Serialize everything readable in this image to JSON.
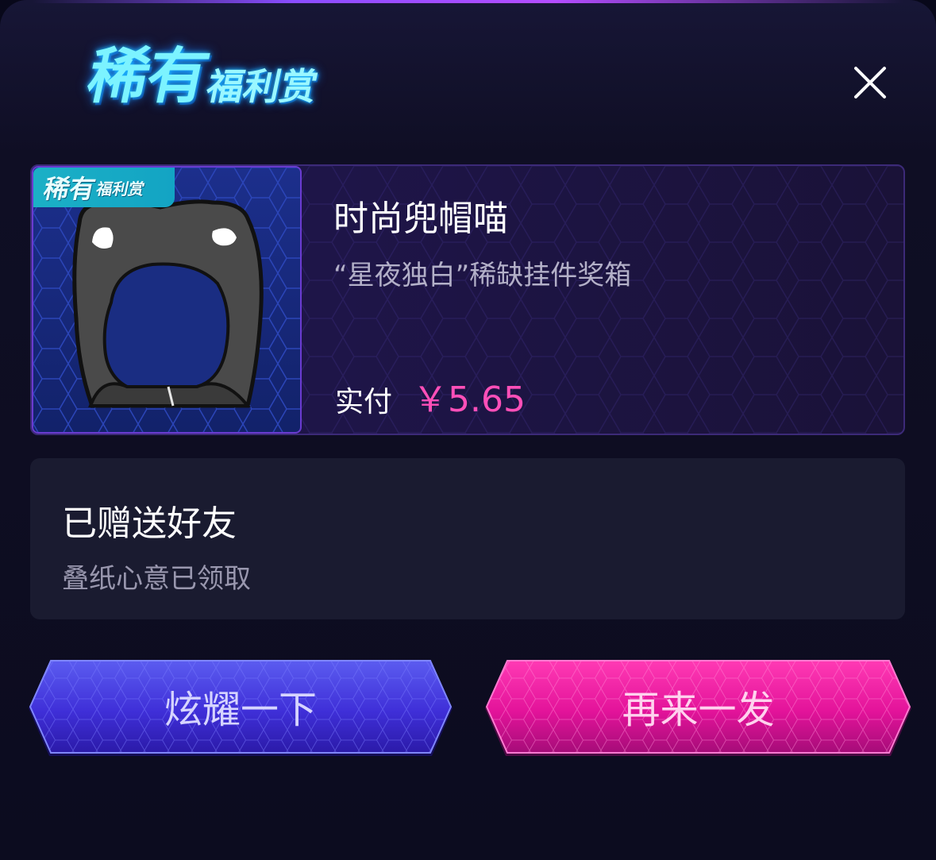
{
  "header": {
    "brand_main": "稀有",
    "brand_sub": "福利赏",
    "close_icon": "close-icon"
  },
  "item": {
    "badge_main": "稀有",
    "badge_sub": "福利赏",
    "name": "时尚兜帽喵",
    "description": "“星夜独白”稀缺挂件奖箱",
    "price_label": "实付",
    "price_value": "￥5.65",
    "thumbnail_icon": "hooded-cat-image"
  },
  "gift": {
    "title": "已赠送好友",
    "subtitle": "叠纸心意已领取"
  },
  "actions": {
    "show_off_label": "炫耀一下",
    "again_label": "再来一发"
  },
  "colors": {
    "price": "#ff4fb8",
    "brand": "#7cf3ff",
    "show_button": "#4b3de0",
    "again_button": "#e8189a"
  }
}
